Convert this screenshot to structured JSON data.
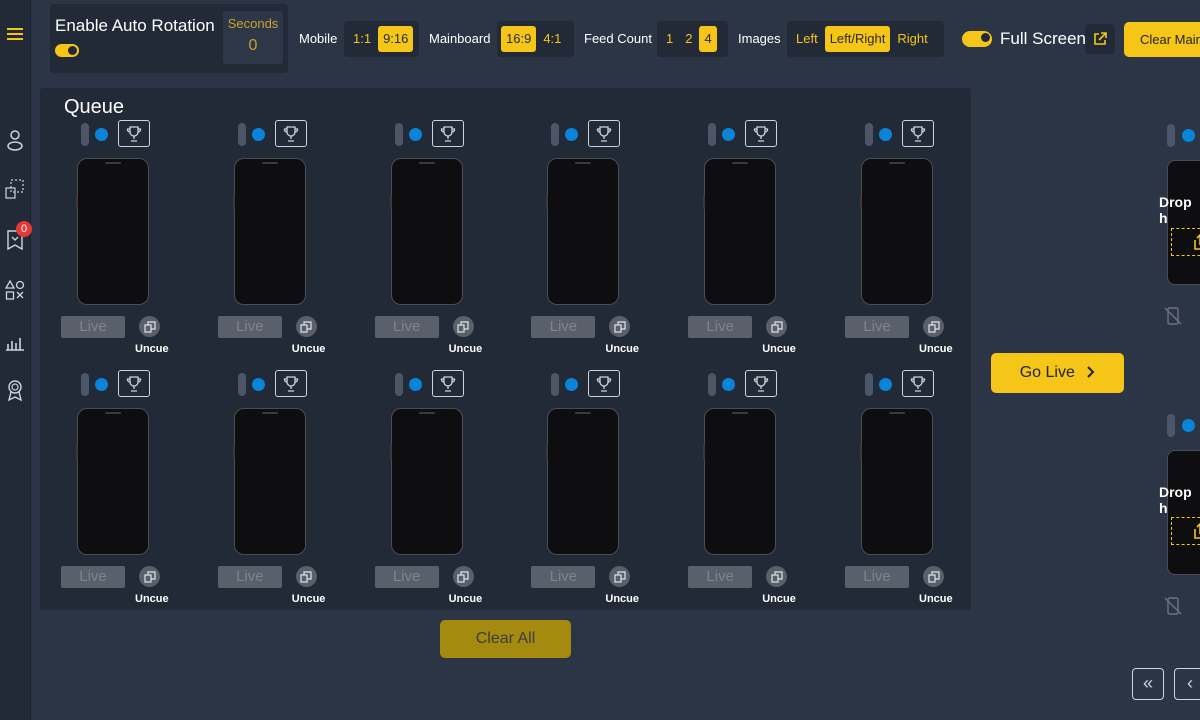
{
  "sidebar": {
    "badge_count": "0"
  },
  "rotation": {
    "title": "Enable Auto Rotation",
    "seconds_label": "Seconds",
    "seconds_value": "0",
    "enabled": true
  },
  "mobile": {
    "label": "Mobile",
    "options": [
      "1:1",
      "9:16"
    ],
    "selected": "9:16"
  },
  "mainboard": {
    "label": "Mainboard",
    "options": [
      "16:9",
      "4:1"
    ],
    "selected": "16:9"
  },
  "feed_count": {
    "label": "Feed Count",
    "options": [
      "1",
      "2",
      "4"
    ],
    "selected": "4"
  },
  "images": {
    "label": "Images",
    "options": [
      "Left",
      "Left/Right",
      "Right"
    ],
    "selected": "Left/Right"
  },
  "full_screen": {
    "label": "Full Screen",
    "enabled": true
  },
  "toolbar": {
    "clear_main_label": "Clear Main"
  },
  "queue": {
    "title": "Queue",
    "slot_count": 12,
    "live_label": "Live",
    "uncue_label": "Uncue",
    "clear_all_label": "Clear All"
  },
  "go_live_label": "Go Live",
  "main_board": {
    "drop_label": "Drop h"
  },
  "colors": {
    "accent": "#f5c518",
    "panel": "#222a37",
    "background": "#2c3546",
    "dot": "#0a84d8",
    "badge": "#e53935"
  }
}
